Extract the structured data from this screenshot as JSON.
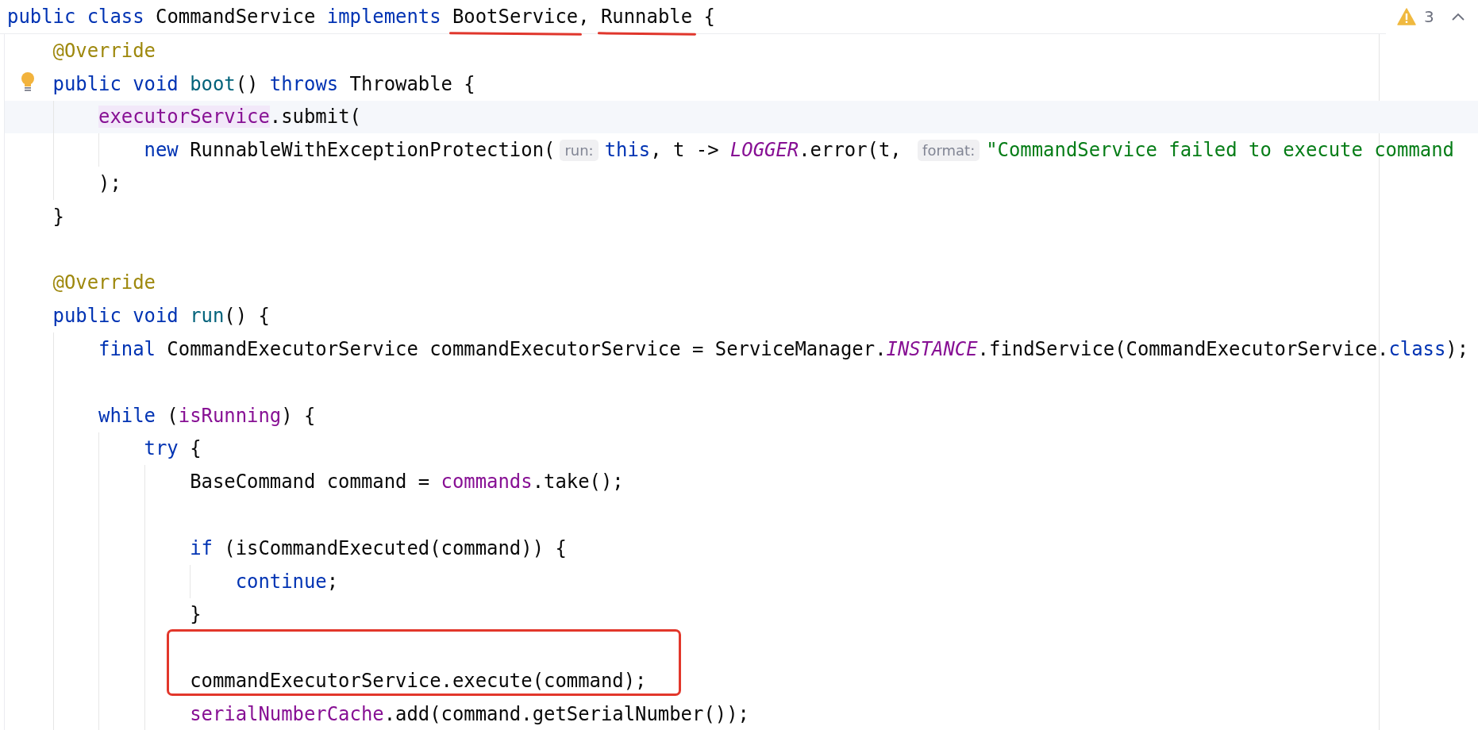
{
  "inspection_widget": {
    "warning_count": "3"
  },
  "code": [
    {
      "tokens": [
        {
          "kind": "keyword",
          "text": "public class"
        },
        {
          "kind": "plain",
          "text": " CommandService "
        },
        {
          "kind": "keyword",
          "text": "implements "
        },
        {
          "kind": "plain",
          "text": "BootService",
          "underlined": true
        },
        {
          "kind": "plain",
          "text": ", "
        },
        {
          "kind": "plain",
          "text": "Runnable",
          "underlined": true
        },
        {
          "kind": "plain",
          "text": " {"
        }
      ],
      "children": [
        {
          "tokens": [
            {
              "kind": "annotation",
              "text": "@Override"
            }
          ]
        },
        {
          "tokens": [
            {
              "kind": "keyword",
              "text": "public void "
            },
            {
              "kind": "method",
              "text": "boot"
            },
            {
              "kind": "plain",
              "text": "() "
            },
            {
              "kind": "keyword",
              "text": "throws"
            },
            {
              "kind": "plain",
              "text": " Throwable {"
            }
          ],
          "intention_bulb": true,
          "children": [
            {
              "tokens": [
                {
                  "kind": "field",
                  "text": "executorService",
                  "highlighted": true
                },
                {
                  "kind": "plain",
                  "text": ".submit("
                }
              ],
              "current": true,
              "children": [
                {
                  "tokens": [
                    {
                      "kind": "keyword",
                      "text": "new"
                    },
                    {
                      "kind": "plain",
                      "text": " RunnableWithExceptionProtection("
                    },
                    {
                      "kind": "hint",
                      "text": "run:"
                    },
                    {
                      "kind": "keyword",
                      "text": "this"
                    },
                    {
                      "kind": "plain",
                      "text": ", t -> "
                    },
                    {
                      "kind": "constant",
                      "text": "LOGGER"
                    },
                    {
                      "kind": "plain",
                      "text": ".error(t, "
                    },
                    {
                      "kind": "hint",
                      "text": "format:"
                    },
                    {
                      "kind": "string",
                      "text": "\"CommandService failed to execute command"
                    }
                  ]
                }
              ]
            },
            {
              "tokens": [
                {
                  "kind": "plain",
                  "text": ");"
                }
              ]
            }
          ]
        },
        {
          "tokens": [
            {
              "kind": "plain",
              "text": "}"
            }
          ]
        },
        {
          "kind": "blank"
        },
        {
          "tokens": [
            {
              "kind": "annotation",
              "text": "@Override"
            }
          ]
        },
        {
          "tokens": [
            {
              "kind": "keyword",
              "text": "public void "
            },
            {
              "kind": "method",
              "text": "run"
            },
            {
              "kind": "plain",
              "text": "() {"
            }
          ],
          "children": [
            {
              "tokens": [
                {
                  "kind": "keyword",
                  "text": "final"
                },
                {
                  "kind": "plain",
                  "text": " CommandExecutorService commandExecutorService = ServiceManager."
                },
                {
                  "kind": "constant",
                  "text": "INSTANCE"
                },
                {
                  "kind": "plain",
                  "text": ".findService(CommandExecutorService."
                },
                {
                  "kind": "keyword",
                  "text": "class"
                },
                {
                  "kind": "plain",
                  "text": ");"
                }
              ]
            },
            {
              "kind": "blank"
            },
            {
              "tokens": [
                {
                  "kind": "keyword",
                  "text": "while"
                },
                {
                  "kind": "plain",
                  "text": " ("
                },
                {
                  "kind": "field",
                  "text": "isRunning"
                },
                {
                  "kind": "plain",
                  "text": ") {"
                }
              ],
              "children": [
                {
                  "tokens": [
                    {
                      "kind": "keyword",
                      "text": "try"
                    },
                    {
                      "kind": "plain",
                      "text": " {"
                    }
                  ],
                  "children": [
                    {
                      "tokens": [
                        {
                          "kind": "plain",
                          "text": "BaseCommand command = "
                        },
                        {
                          "kind": "field",
                          "text": "commands"
                        },
                        {
                          "kind": "plain",
                          "text": ".take();"
                        }
                      ]
                    },
                    {
                      "kind": "blank"
                    },
                    {
                      "tokens": [
                        {
                          "kind": "keyword",
                          "text": "if"
                        },
                        {
                          "kind": "plain",
                          "text": " (isCommandExecuted(command)) {"
                        }
                      ],
                      "children": [
                        {
                          "tokens": [
                            {
                              "kind": "keyword",
                              "text": "continue"
                            },
                            {
                              "kind": "plain",
                              "text": ";"
                            }
                          ]
                        }
                      ]
                    },
                    {
                      "tokens": [
                        {
                          "kind": "plain",
                          "text": "}"
                        }
                      ]
                    },
                    {
                      "kind": "blank",
                      "boxed": true
                    },
                    {
                      "tokens": [
                        {
                          "kind": "plain",
                          "text": "commandExecutorService.execute(command);"
                        }
                      ],
                      "boxed": true
                    },
                    {
                      "tokens": [
                        {
                          "kind": "field",
                          "text": "serialNumberCache"
                        },
                        {
                          "kind": "plain",
                          "text": ".add(command.getSerialNumber());"
                        }
                      ]
                    }
                  ]
                }
              ]
            }
          ]
        }
      ]
    }
  ]
}
